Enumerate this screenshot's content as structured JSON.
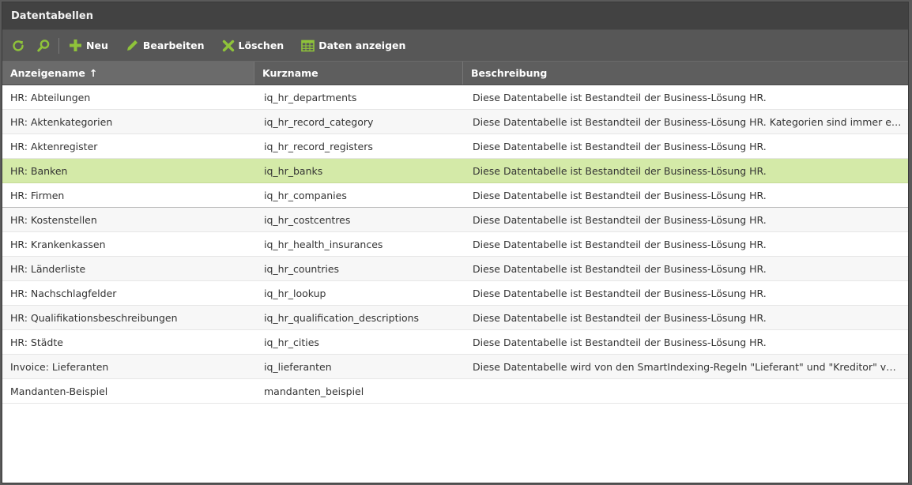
{
  "window": {
    "title": "Datentabellen"
  },
  "colors": {
    "accent": "#8fc33a",
    "selected_row": "#d4eaa8",
    "toolbar": "#575757",
    "titlebar": "#424242"
  },
  "toolbar": {
    "refresh_icon": "refresh-icon",
    "search_icon": "search-icon",
    "new_label": "Neu",
    "edit_label": "Bearbeiten",
    "delete_label": "Löschen",
    "view_data_label": "Daten anzeigen"
  },
  "table": {
    "columns": [
      "Anzeigename",
      "Kurzname",
      "Beschreibung"
    ],
    "sort_indicator": "↑",
    "rows": [
      {
        "name": "HR: Abteilungen",
        "short": "iq_hr_departments",
        "desc": "Diese Datentabelle ist Bestandteil der Business-Lösung HR."
      },
      {
        "name": "HR: Aktenkategorien",
        "short": "iq_hr_record_category",
        "desc": "Diese Datentabelle ist Bestandteil der Business-Lösung HR. Kategorien sind immer eine Unterebene von Aktenregistern."
      },
      {
        "name": "HR: Aktenregister",
        "short": "iq_hr_record_registers",
        "desc": "Diese Datentabelle ist Bestandteil der Business-Lösung HR."
      },
      {
        "name": "HR: Banken",
        "short": "iq_hr_banks",
        "desc": "Diese Datentabelle ist Bestandteil der Business-Lösung HR."
      },
      {
        "name": "HR: Firmen",
        "short": "iq_hr_companies",
        "desc": "Diese Datentabelle ist Bestandteil der Business-Lösung HR."
      },
      {
        "name": "HR: Kostenstellen",
        "short": "iq_hr_costcentres",
        "desc": "Diese Datentabelle ist Bestandteil der Business-Lösung HR."
      },
      {
        "name": "HR: Krankenkassen",
        "short": "iq_hr_health_insurances",
        "desc": "Diese Datentabelle ist Bestandteil der Business-Lösung HR."
      },
      {
        "name": "HR: Länderliste",
        "short": "iq_hr_countries",
        "desc": "Diese Datentabelle ist Bestandteil der Business-Lösung HR."
      },
      {
        "name": "HR: Nachschlagfelder",
        "short": "iq_hr_lookup",
        "desc": "Diese Datentabelle ist Bestandteil der Business-Lösung HR."
      },
      {
        "name": "HR: Qualifikationsbeschreibungen",
        "short": "iq_hr_qualification_descriptions",
        "desc": "Diese Datentabelle ist Bestandteil der Business-Lösung HR."
      },
      {
        "name": "HR: Städte",
        "short": "iq_hr_cities",
        "desc": "Diese Datentabelle ist Bestandteil der Business-Lösung HR."
      },
      {
        "name": "Invoice: Lieferanten",
        "short": "iq_lieferanten",
        "desc": "Diese Datentabelle wird von den SmartIndexing-Regeln \"Lieferant\" und \"Kreditor\" verwendet."
      },
      {
        "name": "Mandanten-Beispiel",
        "short": "mandanten_beispiel",
        "desc": ""
      }
    ],
    "selected_index": 3
  }
}
